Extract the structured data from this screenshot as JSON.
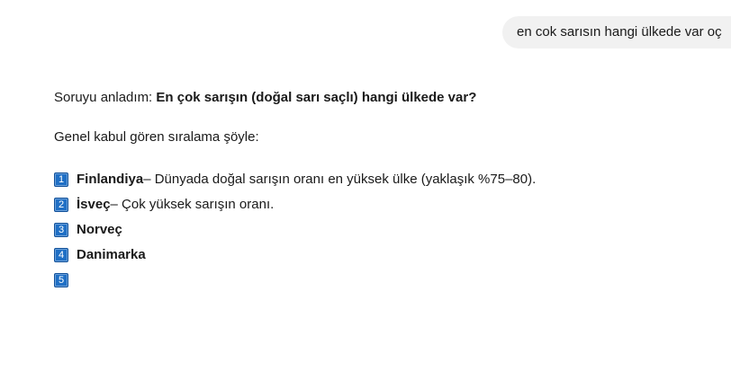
{
  "user_message": "en cok sarısın hangi ülkede var oç",
  "assistant": {
    "intro_prefix": "Soruyu anladım: ",
    "intro_question": "En çok sarışın (doğal sarı saçlı) hangi ülkede var?",
    "ranking_intro": "Genel kabul gören sıralama şöyle:",
    "items": [
      {
        "number": "1",
        "country": "Finlandiya",
        "detail": " – Dünyada doğal sarışın oranı en yüksek ülke (yaklaşık %75–80)."
      },
      {
        "number": "2",
        "country": "İsveç",
        "detail": " – Çok yüksek sarışın oranı."
      },
      {
        "number": "3",
        "country": "Norveç",
        "detail": ""
      },
      {
        "number": "4",
        "country": "Danimarka",
        "detail": ""
      },
      {
        "number": "5",
        "country": "",
        "detail": ""
      }
    ]
  },
  "colors": {
    "badge": "#1f6fc5",
    "bubble": "#f1f1f1"
  }
}
